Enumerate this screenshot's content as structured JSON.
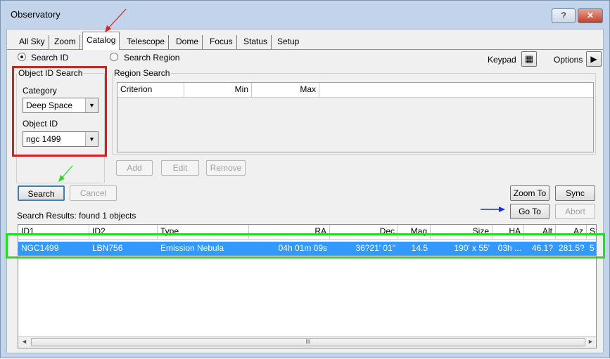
{
  "window": {
    "title": "Observatory",
    "help_label": "?",
    "close_label": "✕"
  },
  "tabs": [
    "All Sky",
    "Zoom",
    "Catalog",
    "Telescope",
    "Dome",
    "Focus",
    "Status",
    "Setup"
  ],
  "mode": {
    "search_id": "Search ID",
    "search_region": "Search Region"
  },
  "toolbar": {
    "keypad": "Keypad",
    "options": "Options"
  },
  "object_id_search": {
    "legend": "Object ID Search",
    "category_label": "Category",
    "category_value": "Deep Space",
    "object_label": "Object ID",
    "object_value": "ngc 1499"
  },
  "region_search": {
    "legend": "Region Search",
    "columns": [
      "Criterion",
      "Min",
      "Max"
    ],
    "add": "Add",
    "edit": "Edit",
    "remove": "Remove"
  },
  "actions": {
    "search": "Search",
    "cancel": "Cancel",
    "zoom_to": "Zoom To",
    "sync": "Sync",
    "go_to": "Go To",
    "abort": "Abort"
  },
  "results": {
    "status": "Search Results: found 1 objects",
    "columns": [
      "ID1",
      "ID2",
      "Type",
      "RA",
      "Dec",
      "Mag",
      "Size",
      "HA",
      "Alt",
      "Az",
      "SI"
    ],
    "rows": [
      [
        "NGC1499",
        "LBN756",
        "Emission Nebula",
        "04h 01m 09s",
        "36?21' 01\"",
        "14.5",
        "190' x 55'",
        "03h ...",
        "46.1?",
        "281.5?",
        "5"
      ]
    ],
    "scroll_mark": "III"
  },
  "colors": {
    "selection": "#3399ff",
    "red_box": "#d42020",
    "green_box": "#22dd22",
    "blue_arrow": "#1a2fd6"
  }
}
